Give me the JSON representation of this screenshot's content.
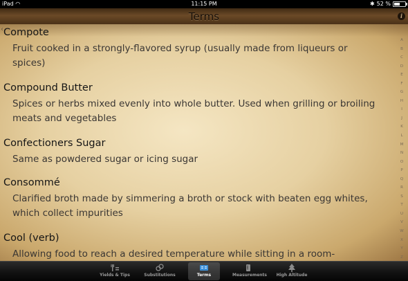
{
  "status_bar": {
    "device": "iPad",
    "time": "11:15 PM",
    "battery": "52 %"
  },
  "header": {
    "title": "Terms",
    "info_label": "i"
  },
  "entries": [
    {
      "term": "Compote",
      "definition": "Fruit cooked in a strongly-flavored syrup (usually made from liqueurs or spices)"
    },
    {
      "term": "Compound Butter",
      "definition": "Spices or herbs mixed evenly into whole butter.  Used when grilling or broiling meats and vegetables"
    },
    {
      "term": "Confectioners Sugar",
      "definition": "Same as powdered sugar or icing sugar"
    },
    {
      "term": "Consommé",
      "definition": "Clarified broth made by simmering a broth or stock with beaten egg whites, which collect impurities"
    },
    {
      "term": "Cool (verb)",
      "definition": "Allowing food to reach a desired temperature while sitting in a room-"
    }
  ],
  "alphabet_index": [
    "A",
    "B",
    "C",
    "D",
    "E",
    "F",
    "G",
    "H",
    "I",
    "J",
    "K",
    "L",
    "M",
    "N",
    "O",
    "P",
    "Q",
    "R",
    "S",
    "T",
    "U",
    "V",
    "W",
    "X",
    "Y",
    "Z"
  ],
  "tab_bar": {
    "tabs": [
      {
        "label": "Yields & Tips",
        "icon": "utensils-icon",
        "active": false
      },
      {
        "label": "Substitutions",
        "icon": "swap-arrows-icon",
        "active": false
      },
      {
        "label": "Terms",
        "icon": "book-icon",
        "active": true
      },
      {
        "label": "Measurements",
        "icon": "measuring-cup-icon",
        "active": false
      },
      {
        "label": "High Altitude",
        "icon": "tree-icon",
        "active": false
      }
    ]
  },
  "colors": {
    "title_bar": "#5a3c1e",
    "parchment": "#e6d2a4",
    "tab_bar": "#141414",
    "active_tab_label": "#ffffff"
  }
}
